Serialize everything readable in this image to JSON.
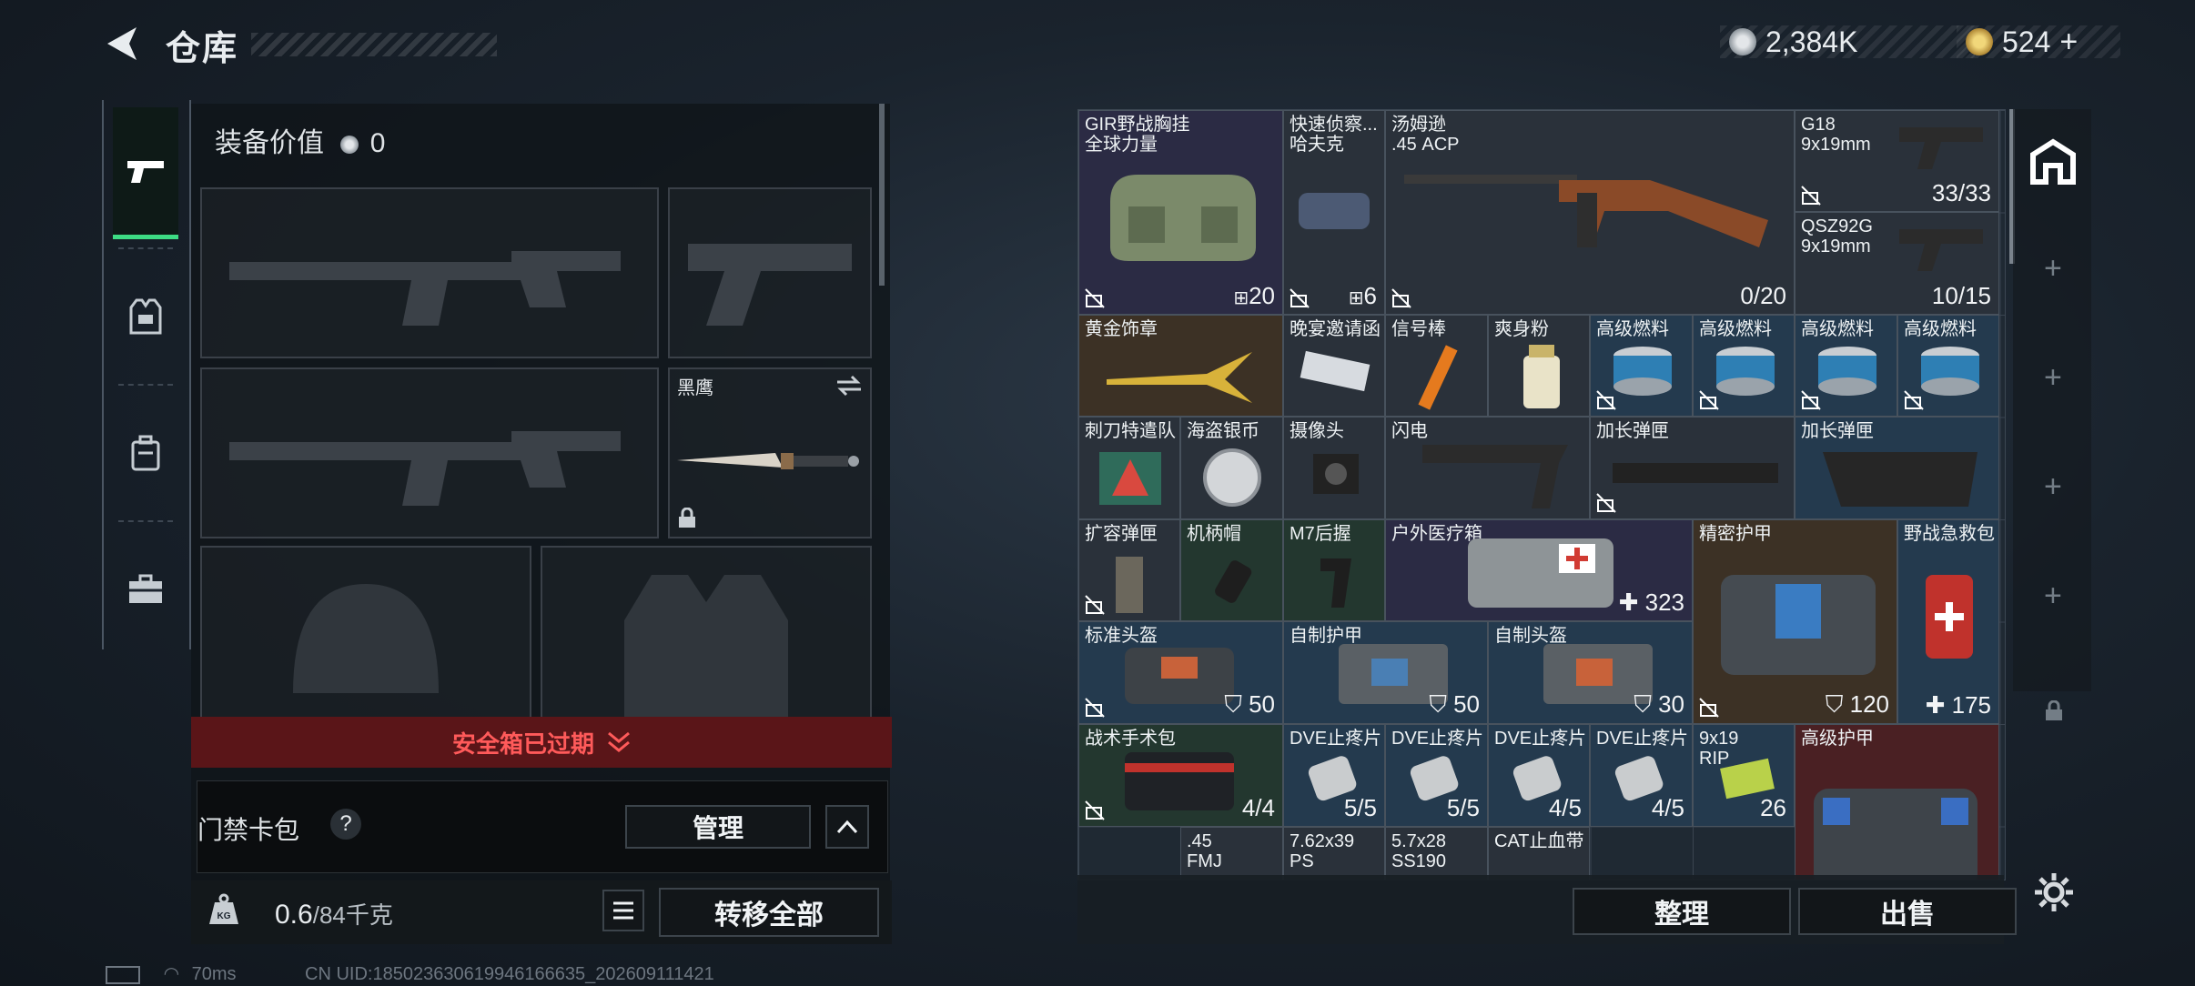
{
  "header": {
    "title": "仓库",
    "silver": "2,384K",
    "gold": "524"
  },
  "equipment": {
    "label": "装备价值",
    "value": "0",
    "knife_name": "黑鹰"
  },
  "safe_box": {
    "text": "安全箱已过期"
  },
  "keycard": {
    "label": "门禁卡包",
    "help": "?",
    "manage": "管理"
  },
  "weight": {
    "current": "0.6",
    "max": "/84千克"
  },
  "transfer_all": "转移全部",
  "actions": {
    "sort": "整理",
    "sell": "出售"
  },
  "status": {
    "ping": "70ms",
    "uid": "CN UID:185023630619946166635_202609111421"
  },
  "inventory": [
    {
      "name": "GIR野战胸挂",
      "sub": "全球力量",
      "count": "20",
      "qty_icon": true
    },
    {
      "name": "快速侦察...",
      "sub": "哈夫克",
      "count": "6",
      "qty_icon": true
    },
    {
      "name": "汤姆逊",
      "sub": ".45 ACP",
      "count": "0/20"
    },
    {
      "name": "G18",
      "sub": "9x19mm",
      "count": "33/33"
    },
    {
      "name": "QSZ92G",
      "sub": "9x19mm",
      "count": "10/15"
    },
    {
      "name": "黄金饰章",
      "sub": "",
      "count": ""
    },
    {
      "name": "晚宴邀请函",
      "sub": "",
      "count": ""
    },
    {
      "name": "信号棒",
      "sub": "",
      "count": ""
    },
    {
      "name": "爽身粉",
      "sub": "",
      "count": ""
    },
    {
      "name": "高级燃料",
      "sub": "",
      "count": ""
    },
    {
      "name": "高级燃料",
      "sub": "",
      "count": ""
    },
    {
      "name": "高级燃料",
      "sub": "",
      "count": ""
    },
    {
      "name": "高级燃料",
      "sub": "",
      "count": ""
    },
    {
      "name": "刺刀特遣队",
      "sub": "",
      "count": ""
    },
    {
      "name": "海盗银币",
      "sub": "",
      "count": ""
    },
    {
      "name": "摄像头",
      "sub": "",
      "count": ""
    },
    {
      "name": "闪电",
      "sub": "",
      "count": ""
    },
    {
      "name": "加长弹匣",
      "sub": "",
      "count": ""
    },
    {
      "name": "加长弹匣",
      "sub": "",
      "count": ""
    },
    {
      "name": "扩容弹匣",
      "sub": "",
      "count": ""
    },
    {
      "name": "机柄帽",
      "sub": "",
      "count": ""
    },
    {
      "name": "M7后握",
      "sub": "",
      "count": ""
    },
    {
      "name": "户外医疗箱",
      "sub": "",
      "count": "323"
    },
    {
      "name": "精密护甲",
      "sub": "",
      "count": "120"
    },
    {
      "name": "野战急救包",
      "sub": "",
      "count": "175"
    },
    {
      "name": "标准头盔",
      "sub": "",
      "count": "50"
    },
    {
      "name": "自制护甲",
      "sub": "",
      "count": "50"
    },
    {
      "name": "自制头盔",
      "sub": "",
      "count": "30"
    },
    {
      "name": "战术手术包",
      "sub": "",
      "count": "4/4"
    },
    {
      "name": "DVE止疼片",
      "sub": "",
      "count": "5/5"
    },
    {
      "name": "DVE止疼片",
      "sub": "",
      "count": "5/5"
    },
    {
      "name": "DVE止疼片",
      "sub": "",
      "count": "4/5"
    },
    {
      "name": "DVE止疼片",
      "sub": "",
      "count": "4/5"
    },
    {
      "name": "9x19",
      "sub": "RIP",
      "count": "26"
    },
    {
      "name": "高级护甲",
      "sub": "",
      "count": ""
    },
    {
      "name": ".45",
      "sub": "FMJ",
      "count": ""
    },
    {
      "name": "7.62x39",
      "sub": "PS",
      "count": ""
    },
    {
      "name": "5.7x28",
      "sub": "SS190",
      "count": ""
    },
    {
      "name": "CAT止血带",
      "sub": "",
      "count": ""
    }
  ],
  "colors": {
    "accent_green": "#3ddc84",
    "danger_red": "#ff5a5a",
    "gold": "#c9a64a"
  }
}
